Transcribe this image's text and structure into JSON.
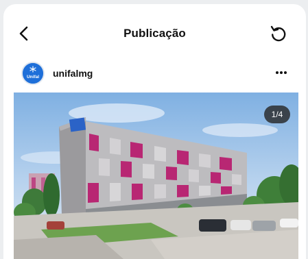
{
  "header": {
    "title": "Publicação",
    "back_icon": "chevron-left-icon",
    "refresh_icon": "refresh-icon"
  },
  "post": {
    "username": "unifalmg",
    "avatar_text": "Unifal",
    "more_icon": "more-horizontal-icon",
    "image": {
      "description_icon": "building-rendering-image",
      "counter": "1/4"
    }
  },
  "colors": {
    "background": "#eceef0",
    "card": "#ffffff",
    "avatar": "#1e6fd9",
    "accent_magenta": "#b8206f",
    "counter_bg": "#282828"
  }
}
